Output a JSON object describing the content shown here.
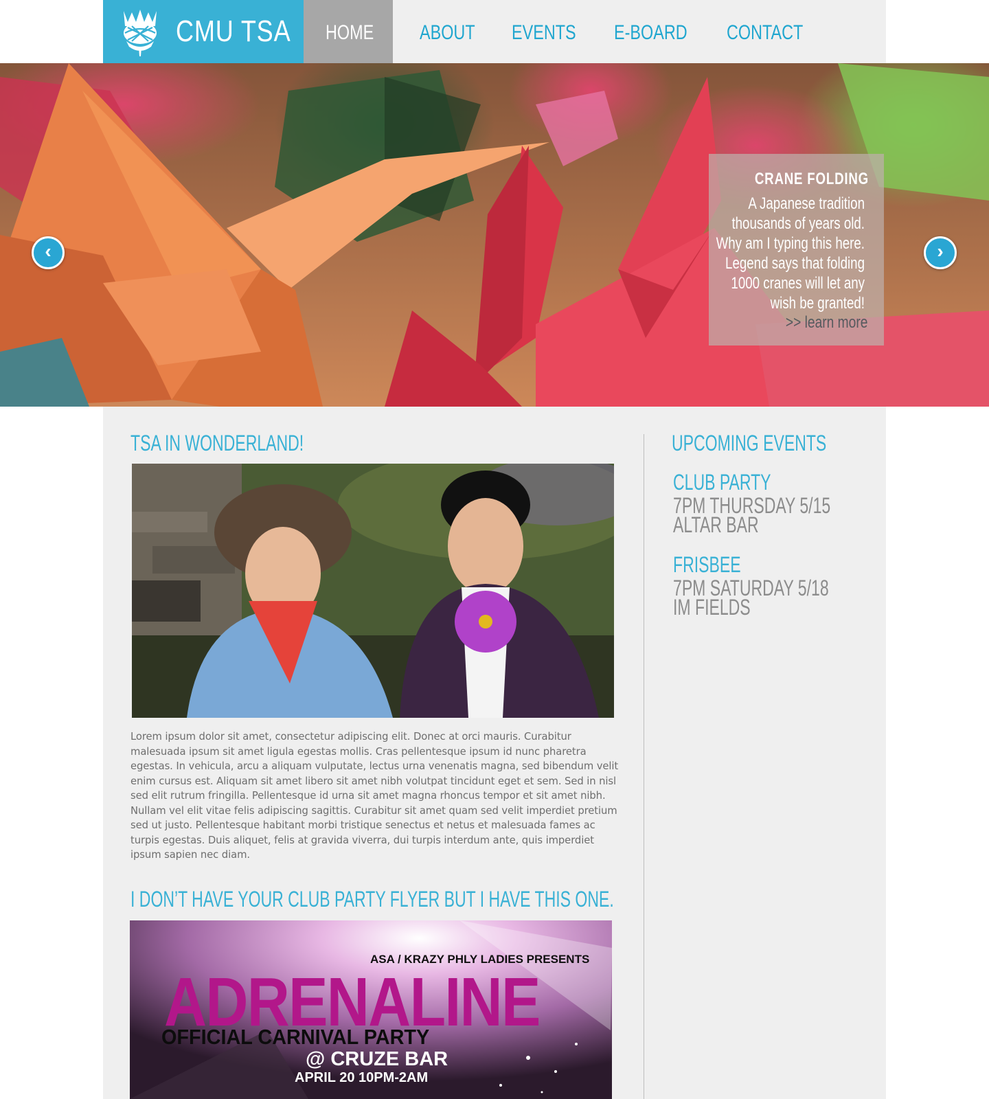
{
  "header": {
    "logo_text": "CMU TSA",
    "nav": [
      {
        "label": "HOME"
      },
      {
        "label": "ABOUT"
      },
      {
        "label": "EVENTS"
      },
      {
        "label": "E-BOARD"
      },
      {
        "label": "CONTACT"
      }
    ]
  },
  "hero": {
    "caption_title": "CRANE FOLDING",
    "caption_body": "A Japanese tradition thousands of years old. Why am I typing this here. Legend says that folding 1000 cranes will let any wish be granted!",
    "caption_link": ">> learn more",
    "prev_label": "‹",
    "next_label": "›"
  },
  "main": {
    "post1": {
      "title": "TSA IN WONDERLAND!",
      "body": "Lorem ipsum dolor sit amet, consectetur adipiscing elit. Donec at orci mauris. Curabitur malesuada ipsum sit amet ligula egestas mollis. Cras pellentesque ipsum id nunc pharetra egestas. In vehicula, arcu a aliquam vulputate, lectus urna venenatis magna, sed bibendum velit enim cursus est. Aliquam sit amet libero sit amet nibh volutpat tincidunt eget et sem. Sed in nisl sed elit rutrum fringilla. Pellentesque id urna sit amet magna rhoncus tempor et sit amet nibh. Nullam vel elit vitae felis adipiscing sagittis. Curabitur sit amet quam sed velit imperdiet pretium sed ut justo. Pellentesque habitant morbi tristique senectus et netus et malesuada fames ac turpis egestas. Duis aliquet, felis at gravida viverra, dui turpis interdum ante, quis imperdiet ipsum sapien nec diam."
    },
    "post2": {
      "title": "I DON’T HAVE YOUR CLUB PARTY FLYER BUT I HAVE THIS ONE.",
      "flyer": {
        "presents": "ASA / KRAZY PHLY LADIES PRESENTS",
        "headline": "ADRENALINE",
        "subhead": "OFFICIAL CARNIVAL PARTY",
        "venue": "@ CRUZE BAR",
        "date": "APRIL 20 10PM-2AM"
      }
    }
  },
  "sidebar": {
    "title": "UPCOMING EVENTS",
    "events": [
      {
        "name": "CLUB PARTY",
        "time": "7PM THURSDAY 5/15",
        "place": "ALTAR BAR"
      },
      {
        "name": "FRISBEE",
        "time": "7PM SATURDAY 5/18",
        "place": "IM FIELDS"
      }
    ]
  },
  "colors": {
    "accent": "#39b1d5",
    "nav_active_bg": "#a7a7a7",
    "content_bg": "#efefef",
    "flyer_magenta": "#b2178a"
  },
  "icons": [
    "thistle-logo-icon",
    "chevron-left-icon",
    "chevron-right-icon"
  ]
}
